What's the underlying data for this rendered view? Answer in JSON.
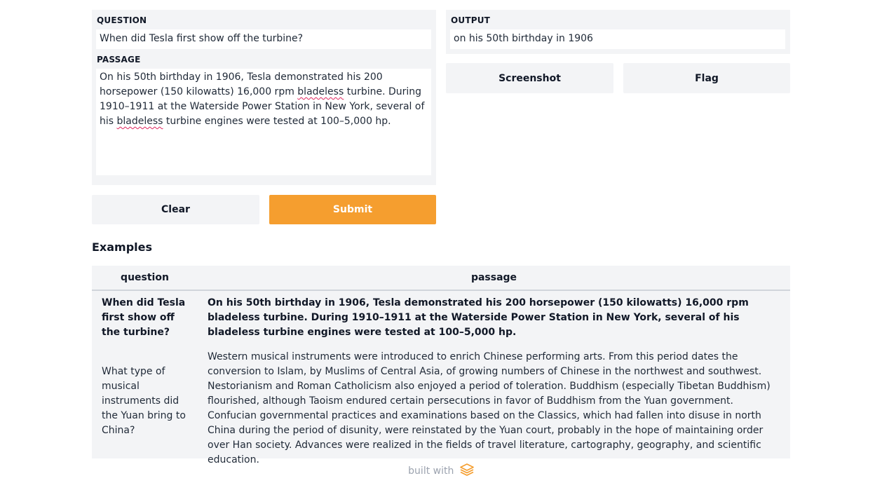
{
  "inputs": {
    "question": {
      "label": "QUESTION",
      "value": "When did Tesla first show off the turbine?"
    },
    "passage": {
      "label": "PASSAGE",
      "value_parts": [
        "On his 50th birthday in 1906, Tesla demonstrated his 200 horsepower (150 kilowatts) 16,000 rpm ",
        "bladeless",
        " turbine. During 1910–1911 at the Waterside Power Station in New York, several of his ",
        "bladeless",
        " turbine engines were tested at 100–5,000 hp."
      ]
    }
  },
  "output": {
    "label": "OUTPUT",
    "value": "on his 50th birthday in 1906"
  },
  "buttons": {
    "clear": "Clear",
    "submit": "Submit",
    "screenshot": "Screenshot",
    "flag": "Flag"
  },
  "examples": {
    "title": "Examples",
    "headers": [
      "question",
      "passage"
    ],
    "rows": [
      {
        "question": "When did Tesla first show off the turbine?",
        "passage": "On his 50th birthday in 1906, Tesla demonstrated his 200 horsepower (150 kilowatts) 16,000 rpm bladeless turbine. During 1910–1911 at the Waterside Power Station in New York, several of his bladeless turbine engines were tested at 100–5,000 hp."
      },
      {
        "question": "What type of musical instruments did the Yuan bring to China?",
        "passage": "Western musical instruments were introduced to enrich Chinese performing arts. From this period dates the conversion to Islam, by Muslims of Central Asia, of growing numbers of Chinese in the northwest and southwest. Nestorianism and Roman Catholicism also enjoyed a period of toleration. Buddhism (especially Tibetan Buddhism) flourished, although Taoism endured certain persecutions in favor of Buddhism from the Yuan government. Confucian governmental practices and examinations based on the Classics, which had fallen into disuse in north China during the period of disunity, were reinstated by the Yuan court, probably in the hope of maintaining order over Han society. Advances were realized in the fields of travel literature, cartography, geography, and scientific education."
      }
    ]
  },
  "footer": {
    "text": "built with",
    "logo_icon": "gradio-logo-icon"
  },
  "colors": {
    "accent": "#f59e2f",
    "panel": "#f3f4f6",
    "spellcheck": "#e0245e"
  }
}
